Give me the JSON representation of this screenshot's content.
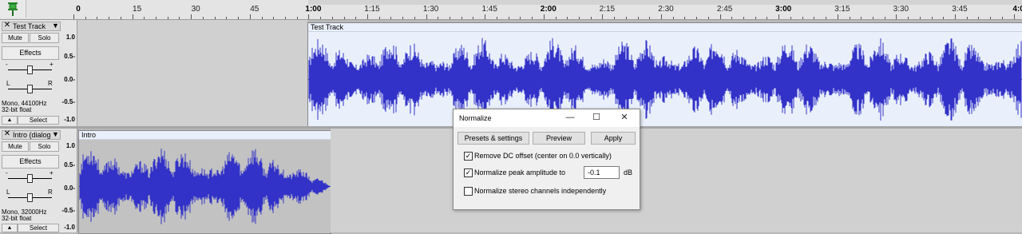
{
  "ruler": {
    "labels": [
      "0",
      "15",
      "30",
      "45",
      "1:00",
      "1:15",
      "1:30",
      "1:45",
      "2:00",
      "2:15",
      "2:30",
      "2:45",
      "3:00",
      "3:15",
      "3:30",
      "3:45",
      "4:0"
    ],
    "pin_icon": "green-pin-icon"
  },
  "tracks": [
    {
      "name": "Test Track",
      "mute": "Mute",
      "solo": "Solo",
      "effects": "Effects",
      "gain_minus": "-",
      "gain_plus": "+",
      "pan_left": "L",
      "pan_right": "R",
      "info_line1": "Mono, 44100Hz",
      "info_line2": "32-bit float",
      "select": "Select",
      "scale": [
        "1.0",
        "0.5-",
        "0.0-",
        "-0.5-",
        "-1.0"
      ],
      "clip_name": "Test Track",
      "wave_color": "#3232c8",
      "clip_bg": "#e9f0fb"
    },
    {
      "name": "Intro (dialogu",
      "mute": "Mute",
      "solo": "Solo",
      "effects": "Effects",
      "gain_minus": "-",
      "gain_plus": "+",
      "pan_left": "L",
      "pan_right": "R",
      "info_line1": "Mono, 32000Hz",
      "info_line2": "32-bit float",
      "select": "Select",
      "scale": [
        "1.0",
        "0.5-",
        "0.0-",
        "-0.5-",
        "-1.0"
      ],
      "clip_name": "Intro",
      "wave_color": "#3232c8",
      "clip_bg": "#c2c2c2"
    }
  ],
  "dialog": {
    "title": "Normalize",
    "minimize": "—",
    "maximize": "☐",
    "close": "✕",
    "presets": "Presets & settings",
    "preview": "Preview",
    "apply": "Apply",
    "options": [
      {
        "label": "Remove DC offset (center on 0.0 vertically)",
        "checked": true
      },
      {
        "label": "Normalize peak amplitude to",
        "checked": true
      },
      {
        "label": "Normalize stereo channels independently",
        "checked": false
      }
    ],
    "peak_value": "-0.1",
    "peak_unit": "dB"
  },
  "colors": {
    "waveform": "#3232c8",
    "track_bg": "#e9f0fb",
    "empty_track": "#d0d0d0"
  }
}
